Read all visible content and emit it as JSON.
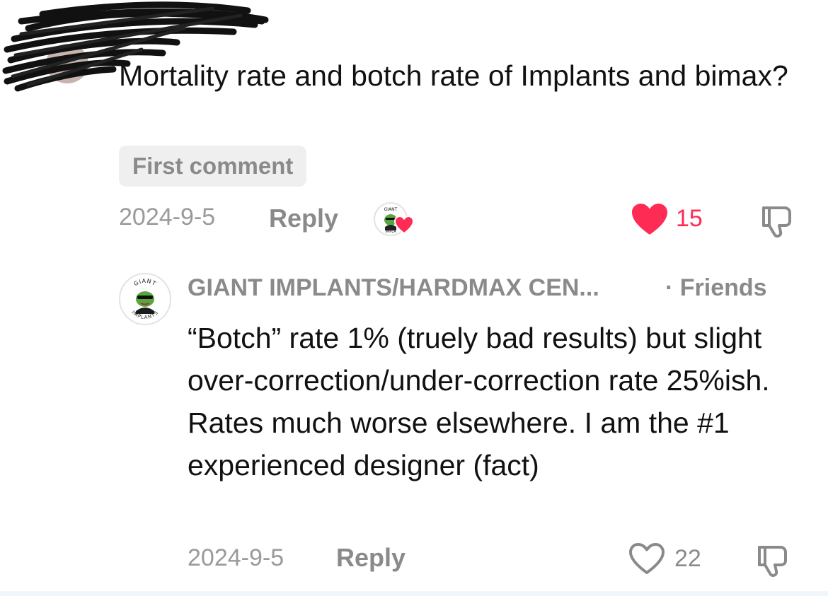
{
  "colors": {
    "text": "#111111",
    "muted": "#8a8a8a",
    "like_active": "#fe2c55",
    "badge_bg": "#efefef"
  },
  "comment": {
    "text": "Mortality rate and botch rate of Implants and bimax?",
    "badge": "First comment",
    "date": "2024-9-5",
    "reply_label": "Reply",
    "like_count": "15",
    "liked": true,
    "liked_by_creator": true
  },
  "reply": {
    "author": "GIANT IMPLANTS/HARDMAX CEN...",
    "relation": "· Friends",
    "avatar_text_top": "GIANT",
    "avatar_text_bottom": "IMPLANTS",
    "text": "“Botch” rate 1% (truely bad results) but slight over-correction/under-correction rate 25%ish. Rates much worse elsewhere. I am the #1 experienced designer (fact)",
    "date": "2024-9-5",
    "reply_label": "Reply",
    "like_count": "22",
    "liked": false
  },
  "icons": {
    "like": "heart-icon",
    "dislike": "thumbs-down-icon",
    "creator_like": "creator-liked-avatar-icon"
  }
}
